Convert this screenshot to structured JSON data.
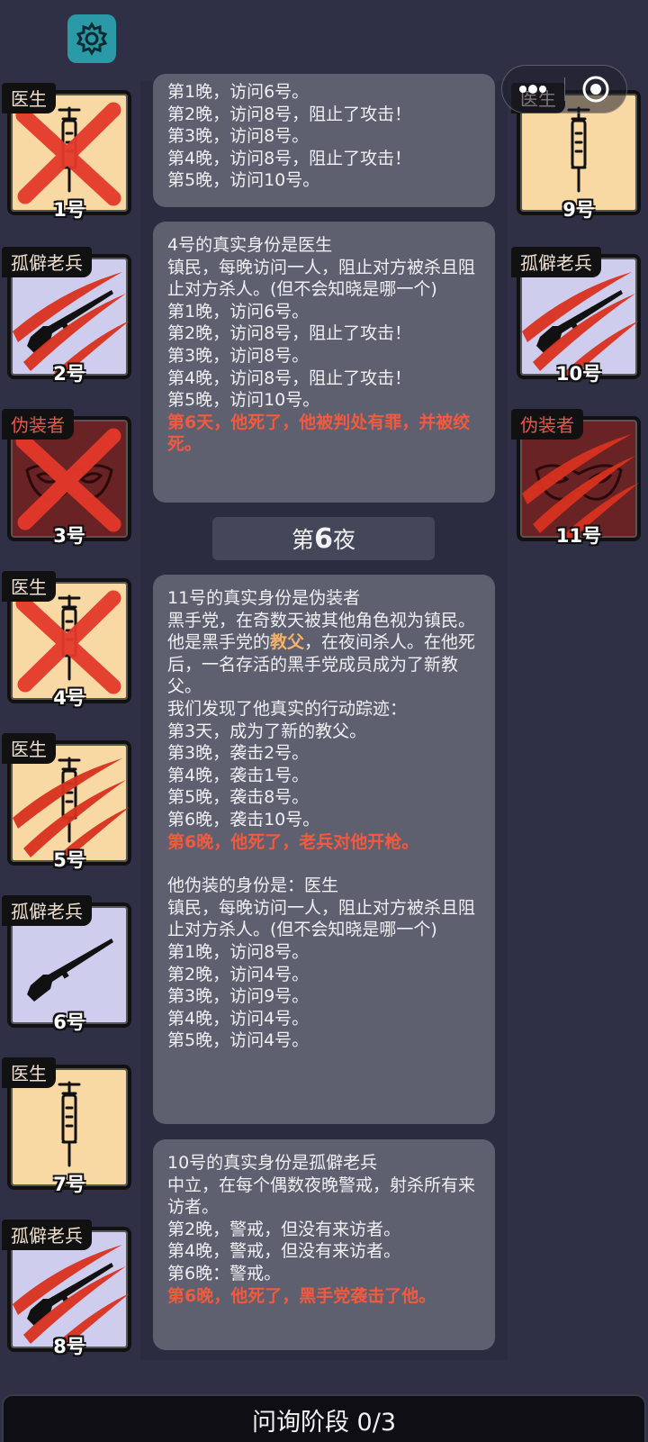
{
  "top_bar": {
    "settings_icon": "gear-icon",
    "capsule_more_icon": "more-dots-icon",
    "capsule_close_icon": "target-close-icon"
  },
  "left_cards": [
    {
      "role": "医生",
      "number": "1号",
      "status": "dead",
      "art": "syringe"
    },
    {
      "role": "孤僻老兵",
      "number": "2号",
      "status": "attacked",
      "art": "rifle"
    },
    {
      "role": "伪装者",
      "number": "3号",
      "status": "dead",
      "art": "mask"
    },
    {
      "role": "医生",
      "number": "4号",
      "status": "dead",
      "art": "syringe"
    },
    {
      "role": "医生",
      "number": "5号",
      "status": "attacked",
      "art": "syringe"
    },
    {
      "role": "孤僻老兵",
      "number": "6号",
      "status": "alive",
      "art": "rifle"
    },
    {
      "role": "医生",
      "number": "7号",
      "status": "alive",
      "art": "syringe"
    },
    {
      "role": "孤僻老兵",
      "number": "8号",
      "status": "attacked",
      "art": "rifle"
    }
  ],
  "right_cards": [
    {
      "role": "医生",
      "number": "9号",
      "status": "alive",
      "art": "syringe"
    },
    {
      "role": "孤僻老兵",
      "number": "10号",
      "status": "attacked",
      "art": "rifle"
    },
    {
      "role": "伪装者",
      "number": "11号",
      "status": "attacked",
      "art": "mask"
    }
  ],
  "log_top_partial": {
    "lines": [
      "第1晚，访问6号。",
      "第2晚，访问8号，阻止了攻击！",
      "第3晚，访问8号。",
      "第4晚，访问8号，阻止了攻击！",
      "第5晚，访问10号。"
    ]
  },
  "log_player4": {
    "lines": [
      "4号的真实身份是医生",
      "镇民，每晚访问一人，阻止对方被杀且阻止对方杀人。(但不会知晓是哪一个)",
      "第1晚，访问6号。",
      "第2晚，访问8号，阻止了攻击！",
      "第3晚，访问8号。",
      "第4晚，访问8号，阻止了攻击！",
      "第5晚，访问10号。"
    ],
    "death": "第6天，他死了，他被判处有罪，并被绞死。"
  },
  "night_banner": {
    "prefix": "第",
    "number": "6",
    "suffix": "夜"
  },
  "log_player11": {
    "line1": "11号的真实身份是伪装者",
    "line2": "黑手党，在奇数天被其他角色视为镇民。",
    "line3_before": "他是黑手党的",
    "line3_highlight": "教父",
    "line3_after": "，在夜间杀人。在他死后，一名存活的黑手党成员成为了新教父。",
    "lines_after": [
      "我们发现了他真实的行动踪迹：",
      "第3天，成为了新的教父。",
      "第3晚，袭击2号。",
      "第4晚，袭击1号。",
      "第5晚，袭击8号。",
      "第6晚，袭击10号。"
    ],
    "death": "第6晚，他死了，老兵对他开枪。",
    "disguise_lines": [
      "他伪装的身份是：医生",
      "镇民，每晚访问一人，阻止对方被杀且阻止对方杀人。(但不会知晓是哪一个)",
      "第1晚，访问8号。",
      "第2晚，访问4号。",
      "第3晚，访问9号。",
      "第4晚，访问4号。",
      "第5晚，访问4号。"
    ]
  },
  "log_player10": {
    "lines": [
      "10号的真实身份是孤僻老兵",
      "中立，在每个偶数夜晚警戒，射杀所有来访者。",
      "第2晚，警戒，但没有来访者。",
      "第4晚，警戒，但没有来访者。",
      "第6晚：警戒。"
    ],
    "death": "第6晚，他死了，黑手党袭击了他。"
  },
  "phase": {
    "label": "问询阶段 0/3"
  },
  "colors": {
    "background": "#2f3046",
    "log_card": "#5e606f",
    "death_text": "#f15a3e",
    "highlight_text": "#f5b26a",
    "doctor_card": "#f8d9a4",
    "veteran_card": "#cfcdee",
    "disguiser_card": "#6a2324",
    "settings_button": "#2a9aa6"
  }
}
